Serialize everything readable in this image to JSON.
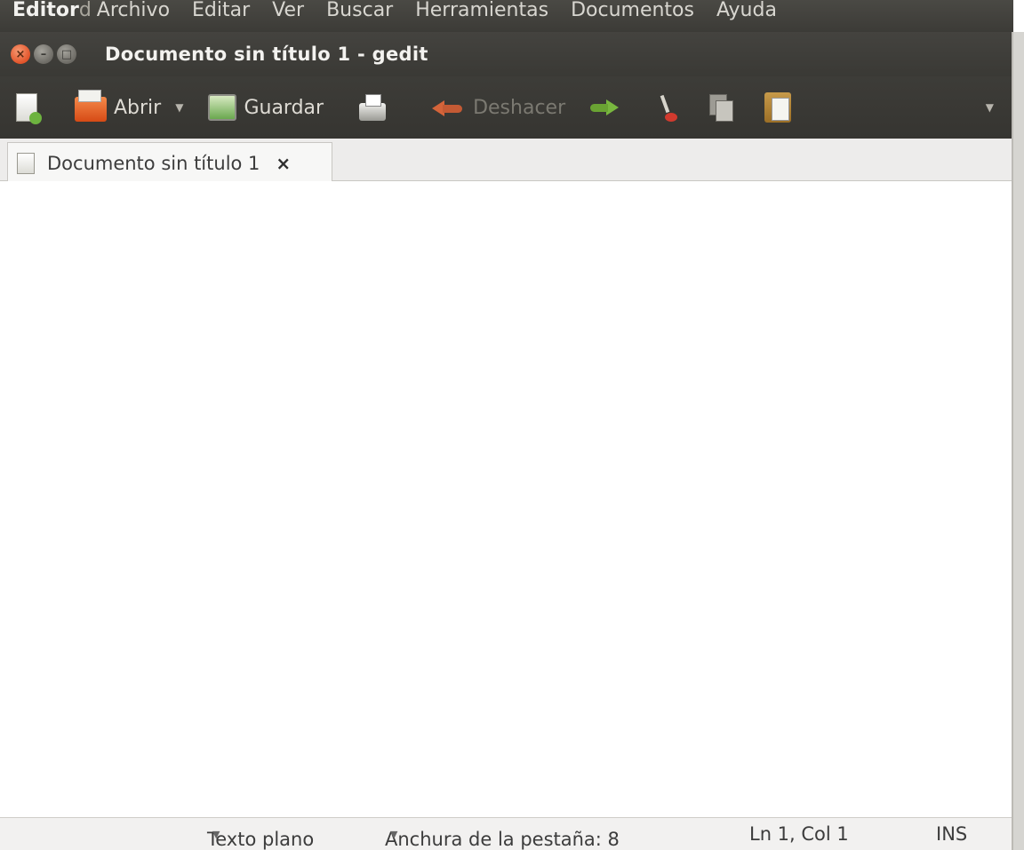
{
  "menubar": {
    "app_name": "Editor",
    "app_suffix": "d",
    "items": [
      "Archivo",
      "Editar",
      "Ver",
      "Buscar",
      "Herramientas",
      "Documentos",
      "Ayuda"
    ]
  },
  "window": {
    "title": "Documento sin título 1 - gedit",
    "close_glyph": "×",
    "min_glyph": "–",
    "max_glyph": "□"
  },
  "toolbar": {
    "open_label": "Abrir",
    "save_label": "Guardar",
    "undo_label": "Deshacer",
    "dropdown_glyph": "▼",
    "overflow_glyph": "▼"
  },
  "tab": {
    "label": "Documento sin título 1",
    "close_glyph": "×"
  },
  "statusbar": {
    "language": "Texto plano",
    "tab_width": "Anchura de la pestaña: 8",
    "position": "Ln 1, Col 1",
    "mode": "INS",
    "arrow_glyph": "▼"
  },
  "colors": {
    "panel_dark": "#3c3b37",
    "close_button": "#e2542a",
    "editor_bg": "#ffffff"
  },
  "icons": [
    "new-document-icon",
    "open-folder-icon",
    "save-icon",
    "print-icon",
    "undo-icon",
    "redo-icon",
    "cut-icon",
    "copy-icon",
    "paste-icon"
  ]
}
